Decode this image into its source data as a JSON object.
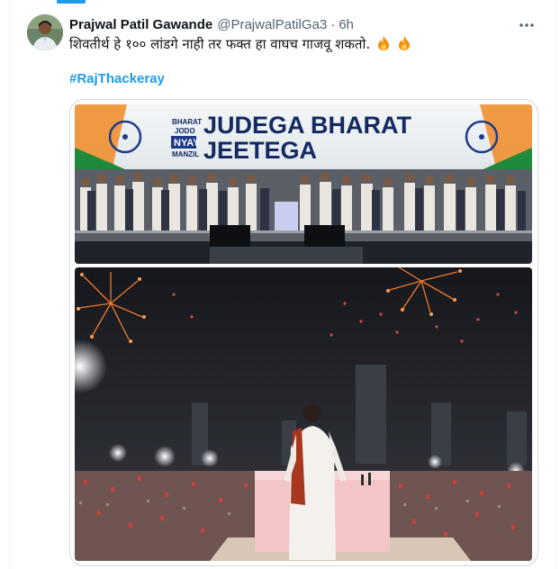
{
  "tweet": {
    "author_name": "Prajwal Patil Gawande",
    "handle": "@PrajwalPatilGa3",
    "separator": "·",
    "time": "6h",
    "more_icon": "more-horizontal-icon",
    "text": "शिवतीर्थ हे १०० लांडगे नाही तर फक्त हा वाघच गाजवू शकतो.",
    "emojis": [
      "fire-icon",
      "fire-icon"
    ],
    "hashtag": "#RajThackeray"
  },
  "media": {
    "photo1": {
      "banner_brand": [
        "BHARAT",
        "JODO",
        "NYAY",
        "MANZIL"
      ],
      "banner_line1": "JUDEGA BHARAT",
      "banner_line2": "JEETEGA"
    },
    "photo2": {}
  },
  "colors": {
    "accent": "#1d9bf0",
    "text": "#0f1419",
    "secondary": "#536471",
    "border": "#cfd9de",
    "banner_blue": "#132a62",
    "saffron": "#f08a24",
    "green": "#1f8a3a"
  }
}
